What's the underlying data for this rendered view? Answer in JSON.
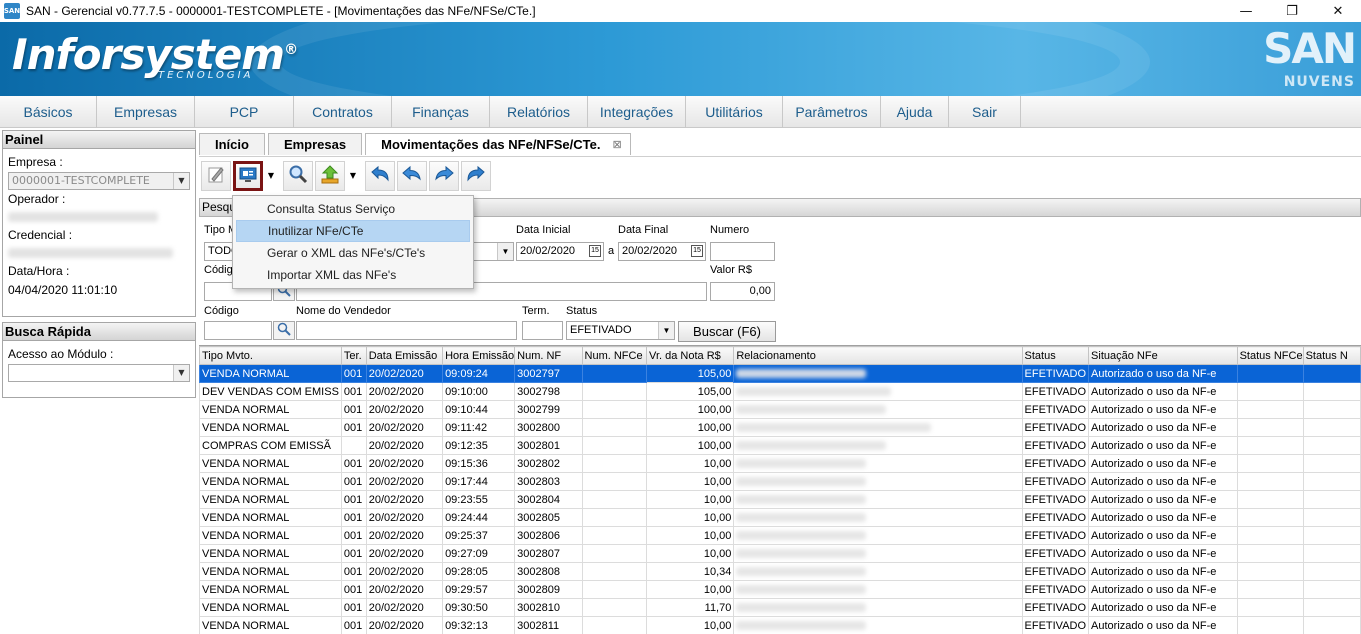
{
  "window": {
    "title": "SAN - Gerencial v0.77.7.5 - 0000001-TESTCOMPLETE - [Movimentações das NFe/NFSe/CTe.]",
    "icon_text": "SAN",
    "min": "—",
    "max": "❐",
    "close": "✕"
  },
  "banner": {
    "brand": "Inforsystem",
    "brand_mark": "®",
    "brand_sub": "TECNOLOGIA",
    "logo_san": "SAN",
    "logo_nuvens": "NUVENS"
  },
  "menu": [
    "Básicos",
    "Empresas",
    "PCP",
    "Contratos",
    "Finanças",
    "Relatórios",
    "Integrações",
    "Utilitários",
    "Parâmetros",
    "Ajuda",
    "Sair"
  ],
  "panel": {
    "header": "Painel",
    "empresa_label": "Empresa :",
    "empresa_value": "0000001-TESTCOMPLETE",
    "operador_label": "Operador :",
    "credencial_label": "Credencial :",
    "datahora_label": "Data/Hora :",
    "datahora_value": "04/04/2020 11:01:10"
  },
  "busca": {
    "header": "Busca Rápida",
    "acesso_label": "Acesso ao Módulo :",
    "acesso_value": ""
  },
  "tabs": [
    {
      "label": "Início"
    },
    {
      "label": "Empresas"
    },
    {
      "label": "Movimentações das NFe/NFSe/CTe."
    }
  ],
  "tab_close": "⊠",
  "search": {
    "header": "Pesqu",
    "tipo_label": "Tipo M",
    "tipo_value": "TODO",
    "data_inicial_label": "Data Inicial",
    "data_inicial_value": "20/02/2020",
    "a_label": "a",
    "data_final_label": "Data Final",
    "data_final_value": "20/02/2020",
    "numero_label": "Numero",
    "numero_value": "",
    "codigo1_label": "Códig",
    "valor_label": "Valor R$",
    "valor_value": "0,00",
    "codigo2_label": "Código",
    "vendedor_label": "Nome do Vendedor",
    "term_label": "Term.",
    "status_label": "Status",
    "status_value": "EFETIVADO",
    "buscar_label": "Buscar (F6)"
  },
  "dropdown": {
    "items": [
      "Consulta Status Serviço",
      "Inutilizar NFe/CTe",
      "Gerar o XML das NFe's/CTe's",
      "Importar XML das NFe's"
    ]
  },
  "grid": {
    "columns": [
      "Tipo Mvto.",
      "Ter.",
      "Data Emissão",
      "Hora Emissão",
      "Num. NF",
      "Num. NFCe",
      "Vr. da Nota R$",
      "Relacionamento",
      "Status",
      "Situação NFe",
      "Status NFCe",
      "Status N"
    ],
    "rows": [
      {
        "tipo": "VENDA NORMAL",
        "ter": "001",
        "data": "20/02/2020",
        "hora": "09:09:24",
        "nf": "3002797",
        "nfce": "",
        "valor": "105,00",
        "status": "EFETIVADO",
        "situacao": "Autorizado o uso da NF-e"
      },
      {
        "tipo": "DEV VENDAS COM EMISS",
        "ter": "001",
        "data": "20/02/2020",
        "hora": "09:10:00",
        "nf": "3002798",
        "nfce": "",
        "valor": "105,00",
        "status": "EFETIVADO",
        "situacao": "Autorizado o uso da NF-e"
      },
      {
        "tipo": "VENDA NORMAL",
        "ter": "001",
        "data": "20/02/2020",
        "hora": "09:10:44",
        "nf": "3002799",
        "nfce": "",
        "valor": "100,00",
        "status": "EFETIVADO",
        "situacao": "Autorizado o uso da NF-e"
      },
      {
        "tipo": "VENDA NORMAL",
        "ter": "001",
        "data": "20/02/2020",
        "hora": "09:11:42",
        "nf": "3002800",
        "nfce": "",
        "valor": "100,00",
        "status": "EFETIVADO",
        "situacao": "Autorizado o uso da NF-e"
      },
      {
        "tipo": "COMPRAS COM EMISSÃ",
        "ter": "",
        "data": "20/02/2020",
        "hora": "09:12:35",
        "nf": "3002801",
        "nfce": "",
        "valor": "100,00",
        "status": "EFETIVADO",
        "situacao": "Autorizado o uso da NF-e"
      },
      {
        "tipo": "VENDA NORMAL",
        "ter": "001",
        "data": "20/02/2020",
        "hora": "09:15:36",
        "nf": "3002802",
        "nfce": "",
        "valor": "10,00",
        "status": "EFETIVADO",
        "situacao": "Autorizado o uso da NF-e"
      },
      {
        "tipo": "VENDA NORMAL",
        "ter": "001",
        "data": "20/02/2020",
        "hora": "09:17:44",
        "nf": "3002803",
        "nfce": "",
        "valor": "10,00",
        "status": "EFETIVADO",
        "situacao": "Autorizado o uso da NF-e"
      },
      {
        "tipo": "VENDA NORMAL",
        "ter": "001",
        "data": "20/02/2020",
        "hora": "09:23:55",
        "nf": "3002804",
        "nfce": "",
        "valor": "10,00",
        "status": "EFETIVADO",
        "situacao": "Autorizado o uso da NF-e"
      },
      {
        "tipo": "VENDA NORMAL",
        "ter": "001",
        "data": "20/02/2020",
        "hora": "09:24:44",
        "nf": "3002805",
        "nfce": "",
        "valor": "10,00",
        "status": "EFETIVADO",
        "situacao": "Autorizado o uso da NF-e"
      },
      {
        "tipo": "VENDA NORMAL",
        "ter": "001",
        "data": "20/02/2020",
        "hora": "09:25:37",
        "nf": "3002806",
        "nfce": "",
        "valor": "10,00",
        "status": "EFETIVADO",
        "situacao": "Autorizado o uso da NF-e"
      },
      {
        "tipo": "VENDA NORMAL",
        "ter": "001",
        "data": "20/02/2020",
        "hora": "09:27:09",
        "nf": "3002807",
        "nfce": "",
        "valor": "10,00",
        "status": "EFETIVADO",
        "situacao": "Autorizado o uso da NF-e"
      },
      {
        "tipo": "VENDA NORMAL",
        "ter": "001",
        "data": "20/02/2020",
        "hora": "09:28:05",
        "nf": "3002808",
        "nfce": "",
        "valor": "10,34",
        "status": "EFETIVADO",
        "situacao": "Autorizado o uso da NF-e"
      },
      {
        "tipo": "VENDA NORMAL",
        "ter": "001",
        "data": "20/02/2020",
        "hora": "09:29:57",
        "nf": "3002809",
        "nfce": "",
        "valor": "10,00",
        "status": "EFETIVADO",
        "situacao": "Autorizado o uso da NF-e"
      },
      {
        "tipo": "VENDA NORMAL",
        "ter": "001",
        "data": "20/02/2020",
        "hora": "09:30:50",
        "nf": "3002810",
        "nfce": "",
        "valor": "11,70",
        "status": "EFETIVADO",
        "situacao": "Autorizado o uso da NF-e"
      },
      {
        "tipo": "VENDA NORMAL",
        "ter": "001",
        "data": "20/02/2020",
        "hora": "09:32:13",
        "nf": "3002811",
        "nfce": "",
        "valor": "10,00",
        "status": "EFETIVADO",
        "situacao": "Autorizado o uso da NF-e"
      }
    ]
  },
  "colors": {
    "accent": "#1d5d8c",
    "selection": "#0a64d6",
    "banner": "#2d9ad6",
    "selected_tool_border": "#7a1414"
  },
  "icons": {
    "toolbar": [
      "edit-icon",
      "nfe-transmit-icon",
      "search-icon",
      "upload-icon",
      "undo-icon",
      "back-icon",
      "forward-icon",
      "redo-icon"
    ]
  }
}
